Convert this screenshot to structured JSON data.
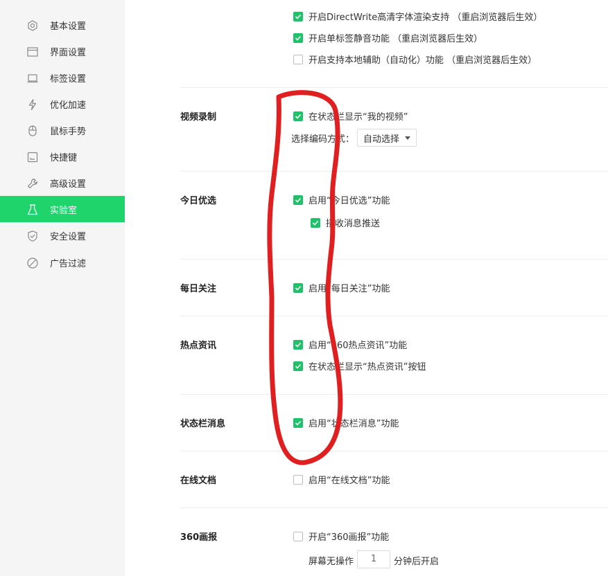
{
  "sidebar": {
    "items": [
      {
        "label": "基本设置",
        "icon": "gear-icon"
      },
      {
        "label": "界面设置",
        "icon": "window-icon"
      },
      {
        "label": "标签设置",
        "icon": "tab-icon"
      },
      {
        "label": "优化加速",
        "icon": "lightning-icon"
      },
      {
        "label": "鼠标手势",
        "icon": "mouse-icon"
      },
      {
        "label": "快捷键",
        "icon": "keyboard-icon"
      },
      {
        "label": "高级设置",
        "icon": "wrench-icon"
      },
      {
        "label": "实验室",
        "icon": "flask-icon",
        "active": true
      },
      {
        "label": "安全设置",
        "icon": "shield-icon"
      },
      {
        "label": "广告过滤",
        "icon": "block-icon"
      }
    ]
  },
  "top_options": [
    {
      "label": "开启DirectWrite高清字体渲染支持  （重启浏览器后生效）",
      "checked": true
    },
    {
      "label": "开启单标签静音功能  （重启浏览器后生效）",
      "checked": true
    },
    {
      "label": "开启支持本地辅助（自动化）功能  （重启浏览器后生效）",
      "checked": false
    }
  ],
  "video": {
    "title": "视频录制",
    "opt1": "在状态栏显示“我的视频”",
    "encode_label": "选择编码方式：",
    "encode_value": "自动选择"
  },
  "today": {
    "title": "今日优选",
    "opt1": "启用“今日优选”功能",
    "opt2": "接收消息推送"
  },
  "daily": {
    "title": "每日关注",
    "opt1": "启用“每日关注”功能"
  },
  "hot": {
    "title": "热点资讯",
    "opt1": "启用“360热点资讯”功能",
    "opt2": "在状态栏显示“热点资讯”按钮"
  },
  "status": {
    "title": "状态栏消息",
    "opt1": "启用“状态栏消息”功能"
  },
  "docs": {
    "title": "在线文档",
    "opt1": "启用“在线文档”功能"
  },
  "pictorial": {
    "title": "360画报",
    "opt1": "开启“360画报”功能",
    "idle_prefix": "屏幕无操作",
    "idle_value": "1",
    "idle_suffix": "分钟后开启"
  },
  "colors": {
    "accent": "#1fd46b",
    "checkbox": "#1fc26a",
    "annotation": "#e02020"
  }
}
